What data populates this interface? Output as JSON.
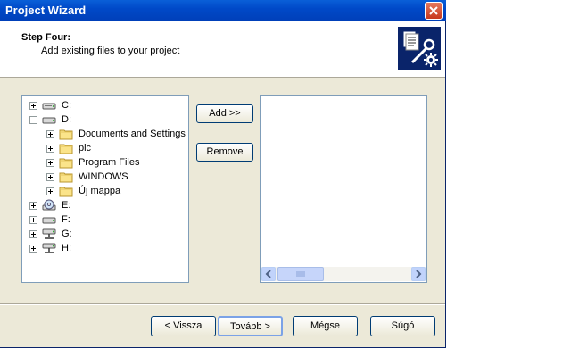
{
  "window": {
    "title": "Project Wizard"
  },
  "header": {
    "step_title": "Step Four:",
    "step_subtitle": "Add existing files to your project",
    "icon": "wizard-tools-icon"
  },
  "tree": {
    "items": [
      {
        "label": "C:",
        "icon": "drive-icon",
        "expander": "plus",
        "level": 0
      },
      {
        "label": "D:",
        "icon": "drive-icon",
        "expander": "minus",
        "level": 0
      },
      {
        "label": "Documents and Settings",
        "icon": "folder-icon",
        "expander": "plus",
        "level": 1
      },
      {
        "label": "pic",
        "icon": "folder-icon",
        "expander": "plus",
        "level": 1
      },
      {
        "label": "Program Files",
        "icon": "folder-icon",
        "expander": "plus",
        "level": 1
      },
      {
        "label": "WINDOWS",
        "icon": "folder-icon",
        "expander": "plus",
        "level": 1
      },
      {
        "label": "Új mappa",
        "icon": "folder-icon",
        "expander": "plus",
        "level": 1
      },
      {
        "label": "E:",
        "icon": "cd-drive-icon",
        "expander": "plus",
        "level": 0
      },
      {
        "label": "F:",
        "icon": "drive-icon",
        "expander": "plus",
        "level": 0
      },
      {
        "label": "G:",
        "icon": "network-drive-icon",
        "expander": "plus",
        "level": 0
      },
      {
        "label": "H:",
        "icon": "network-drive-icon",
        "expander": "plus",
        "level": 0
      }
    ]
  },
  "actions": {
    "add_label": "Add >>",
    "remove_label": "Remove"
  },
  "footer": {
    "back_label": "< Vissza",
    "next_label": "Tovább >",
    "cancel_label": "Mégse",
    "help_label": "Súgó"
  },
  "colors": {
    "titlebar": "#0054e3",
    "dialog_bg": "#ece9d8",
    "close": "#c8381c"
  }
}
